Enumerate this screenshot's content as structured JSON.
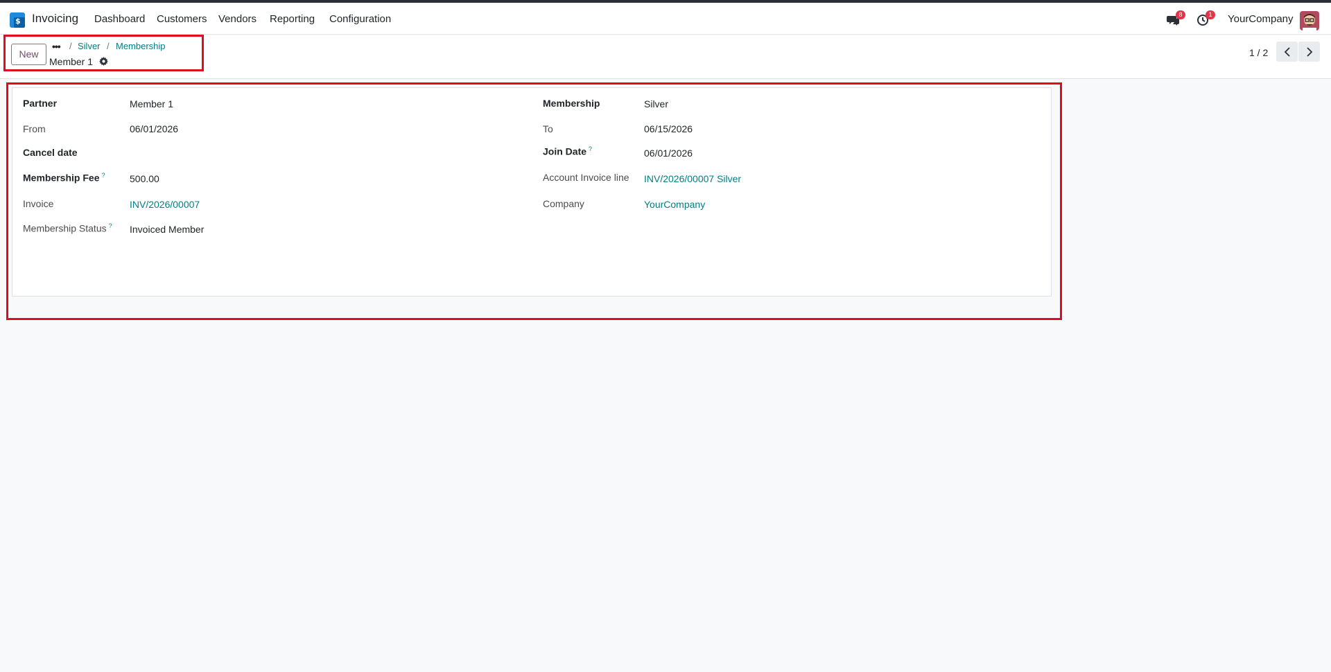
{
  "navbar": {
    "app_name": "Invoicing",
    "menu": [
      "Dashboard",
      "Customers",
      "Vendors",
      "Reporting",
      "Configuration"
    ],
    "messages_count": "8",
    "activities_count": "1",
    "company": "YourCompany"
  },
  "control_panel": {
    "new_label": "New",
    "breadcrumb_dots": "•••",
    "breadcrumbs": [
      "Silver",
      "Membership"
    ],
    "record_title": "Member 1",
    "pager": "1 / 2"
  },
  "form": {
    "left": {
      "partner_label": "Partner",
      "partner_value": "Member 1",
      "from_label": "From",
      "from_value": "06/01/2026",
      "cancel_date_label": "Cancel date",
      "cancel_date_value": "",
      "fee_label": "Membership Fee",
      "fee_value": "500.00",
      "invoice_label": "Invoice",
      "invoice_value": "INV/2026/00007",
      "status_label": "Membership Status",
      "status_value": "Invoiced Member"
    },
    "right": {
      "membership_label": "Membership",
      "membership_value": "Silver",
      "to_label": "To",
      "to_value": "06/15/2026",
      "join_date_label": "Join Date",
      "join_date_value": "06/01/2026",
      "invoice_line_label": "Account Invoice line",
      "invoice_line_value": "INV/2026/00007 Silver",
      "company_label": "Company",
      "company_value": "YourCompany"
    },
    "help_mark": "?"
  },
  "colors": {
    "accent": "#017e84",
    "brand": "#714b67",
    "highlight": "#e00b1c",
    "badge": "#e0364b"
  }
}
